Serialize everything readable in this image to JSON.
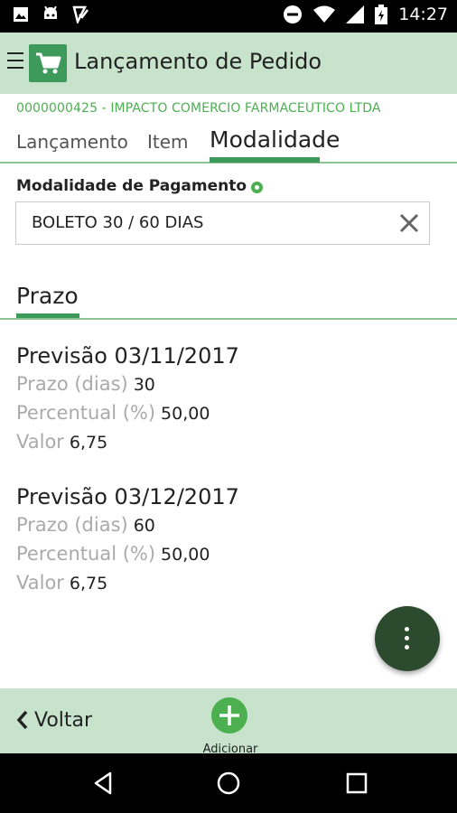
{
  "status_bar": {
    "time": "14:27"
  },
  "app_bar": {
    "title": "Lançamento de Pedido"
  },
  "customer": "0000000425 - IMPACTO COMERCIO FARMACEUTICO LTDA",
  "tabs": [
    {
      "label": "Lançamento"
    },
    {
      "label": "Item"
    },
    {
      "label": "Modalidade"
    }
  ],
  "payment": {
    "label": "Modalidade de Pagamento",
    "value": "BOLETO 30 / 60 DIAS"
  },
  "section": {
    "title": "Prazo"
  },
  "installments": [
    {
      "title": "Previsão 03/11/2017",
      "rows": [
        {
          "label": "Prazo (dias)",
          "value": "30"
        },
        {
          "label": "Percentual (%)",
          "value": "50,00"
        },
        {
          "label": "Valor",
          "value": "6,75"
        }
      ]
    },
    {
      "title": "Previsão 03/12/2017",
      "rows": [
        {
          "label": "Prazo (dias)",
          "value": "60"
        },
        {
          "label": "Percentual (%)",
          "value": "50,00"
        },
        {
          "label": "Valor",
          "value": "6,75"
        }
      ]
    }
  ],
  "bottom_bar": {
    "back_label": "Voltar",
    "add_label": "Adicionar"
  },
  "colors": {
    "primary": "#3e9a5b",
    "bar_background": "#c8e3cc",
    "fab": "#2c4a2e",
    "accent_text": "#4caf50"
  }
}
